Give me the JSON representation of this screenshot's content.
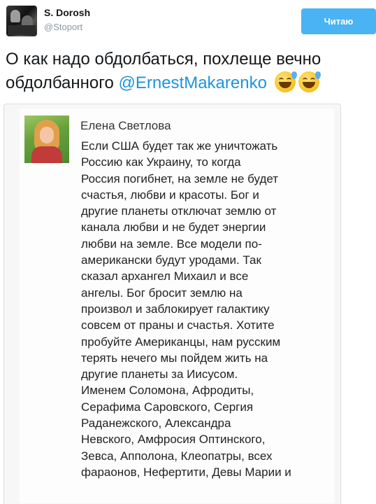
{
  "author": {
    "name": "S. Dorosh",
    "handle": "@Stoport"
  },
  "follow_button": {
    "label": "Читаю"
  },
  "tweet": {
    "text_before": "О как надо обдолбаться, похлеще вечно обдолбанного ",
    "mention": "@ErnestMakarenko",
    "emoji": [
      "grinning-sweat-emoji",
      "grinning-sweat-emoji"
    ]
  },
  "embedded_post": {
    "author": "Елена Светлова",
    "lines": [
      "Если США будет так же уничтожать",
      "Россию как Украину, то когда",
      "Россия погибнет, на земле не будет",
      "счастья, любви и красоты. Бог и",
      "другие планеты отключат землю от",
      "канала любви и не будет энергии",
      "любви на земле. Все модели по-",
      "американски будут уродами. Так",
      "сказал архангел Михаил и все",
      "ангелы. Бог бросит землю на",
      "произвол и заблокирует галактику",
      "совсем от праны и счастья. Хотите",
      "пробуйте Американцы, нам русским",
      "терять нечего мы пойдем жить на",
      "другие планеты за Иисусом.",
      "Именем Соломона, Афродиты,",
      "Серафима Саровского, Сергия",
      "Раданежского, Александра",
      "Невского, Амфросия Оптинского,",
      "Зевса, Апполона, Клеопатры, всех",
      "фараонов, Нефертити, Девы Марии и"
    ]
  },
  "colors": {
    "follow_button_bg": "#4ab3f4",
    "mention": "#1b95e0",
    "handle": "#8899a6"
  }
}
